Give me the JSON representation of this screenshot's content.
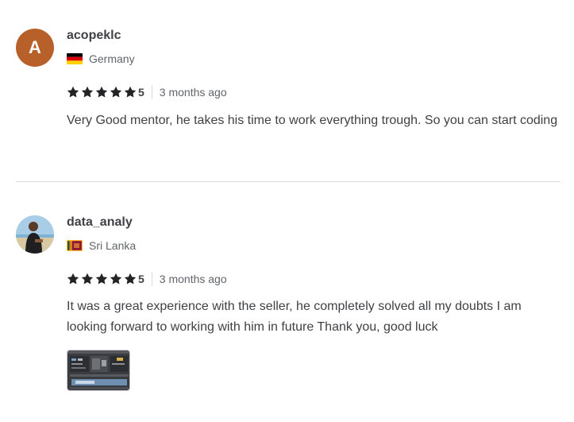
{
  "reviews": [
    {
      "avatar_letter": "A",
      "username": "acopeklc",
      "country": "Germany",
      "flag": "germany-flag",
      "rating": "5",
      "time": "3 months ago",
      "text": "Very Good mentor, he takes his time to work everything trough. So you can start coding"
    },
    {
      "username": "data_analy",
      "country": "Sri Lanka",
      "flag": "sri-lanka-flag",
      "rating": "5",
      "time": "3 months ago",
      "text": "It was a great experience with the seller, he completely solved all my doubts I am looking forward to working with him in future Thank you, good luck",
      "has_attachment": true
    }
  ],
  "colors": {
    "avatar_bg": "#b8602a",
    "text": "#404145",
    "muted": "#62646a",
    "divider": "#dadbdd"
  }
}
